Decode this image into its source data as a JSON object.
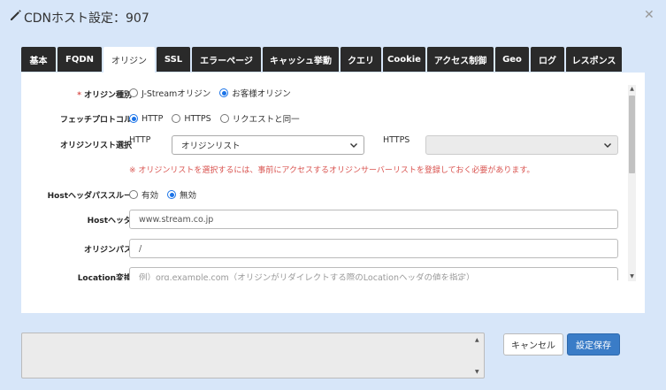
{
  "dialog": {
    "title": "CDNホスト設定：907"
  },
  "tabs": [
    {
      "label": "基本"
    },
    {
      "label": "FQDN"
    },
    {
      "label": "オリジン",
      "active": true
    },
    {
      "label": "SSL"
    },
    {
      "label": "エラーページ"
    },
    {
      "label": "キャッシュ挙動"
    },
    {
      "label": "クエリ"
    },
    {
      "label": "Cookie"
    },
    {
      "label": "アクセス制御"
    },
    {
      "label": "Geo"
    },
    {
      "label": "ログ"
    },
    {
      "label": "レスポンス"
    }
  ],
  "form": {
    "origin_type": {
      "required_mark": "*",
      "label": "オリジン種別",
      "options": [
        "J-Streamオリジン",
        "お客様オリジン"
      ],
      "selected": "お客様オリジン"
    },
    "fetch_protocol": {
      "label": "フェッチプロトコル",
      "options": [
        "HTTP",
        "HTTPS",
        "リクエストと同一"
      ],
      "selected": "HTTP"
    },
    "origin_list": {
      "label": "オリジンリスト選択",
      "http_label": "HTTP",
      "http_value": "オリジンリスト",
      "https_label": "HTTPS",
      "https_value": ""
    },
    "origin_list_note": "※ オリジンリストを選択するには、事前にアクセスするオリジンサーバーリストを登録しておく必要があります。",
    "host_header_passthrough": {
      "label": "Hostヘッダパススルー",
      "options": [
        "有効",
        "無効"
      ],
      "selected": "無効"
    },
    "host_header": {
      "label": "Hostヘッダ",
      "value": "www.stream.co.jp"
    },
    "origin_path": {
      "label": "オリジンパス",
      "value": "/"
    },
    "location_rewrite": {
      "label": "Location変換",
      "placeholder": "例）org.example.com（オリジンがリダイレクトする際のLocationヘッダの値を指定）"
    }
  },
  "footer": {
    "cancel_label": "キャンセル",
    "save_label": "設定保存"
  },
  "icons": {
    "title": "pencil-icon",
    "close": "close-icon",
    "select": "chevron-down-icon"
  },
  "colors": {
    "background": "#d7e6f9",
    "tab_dark": "#2a2a2a",
    "accent": "#1a73e8",
    "warning": "#d9534f",
    "primary_button": "#3a7cc7"
  }
}
